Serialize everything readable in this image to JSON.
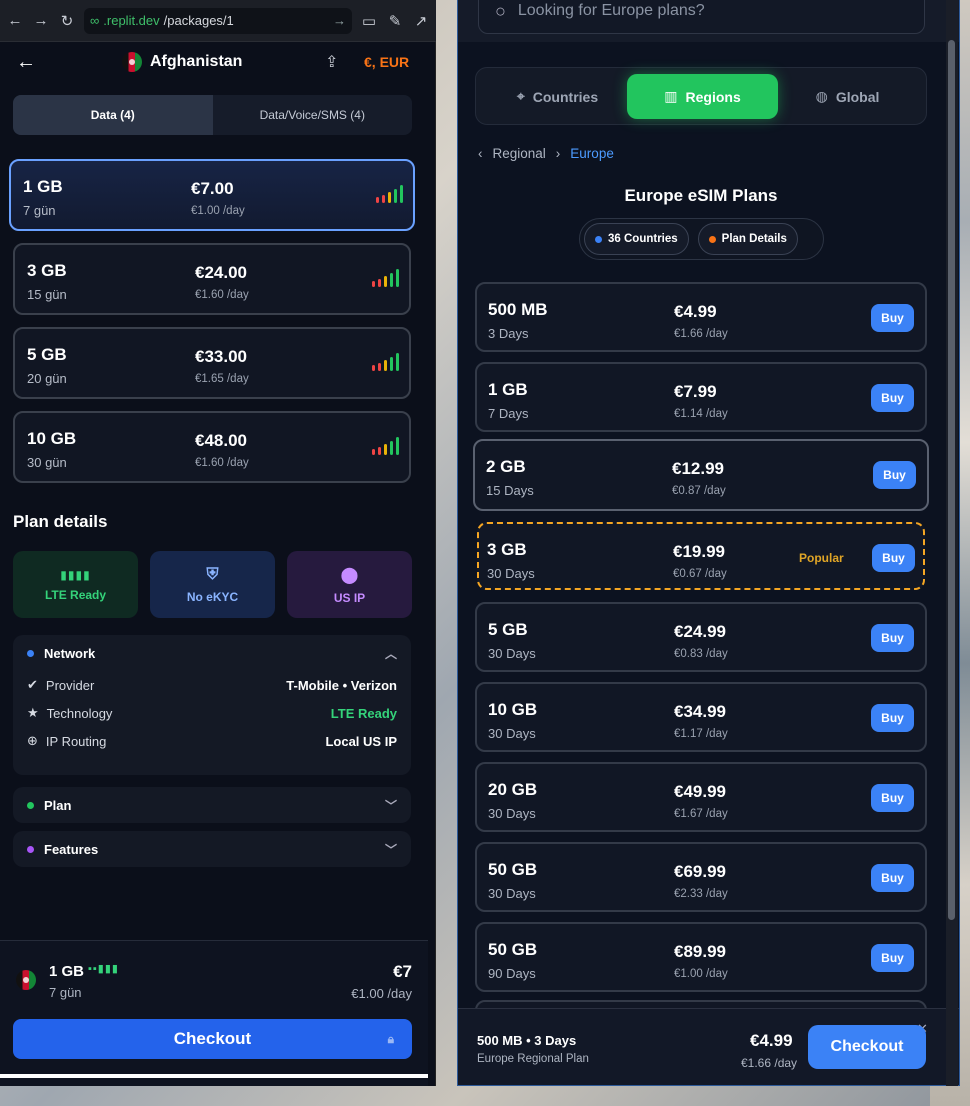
{
  "browser": {
    "url_domain": ".replit.dev",
    "url_path": "/packages/1"
  },
  "left": {
    "country": "Afghanistan",
    "currency": "€, EUR",
    "tabs": [
      {
        "label": "Data (4)"
      },
      {
        "label": "Data/Voice/SMS (4)"
      }
    ],
    "plans": [
      {
        "data": "1 GB",
        "days": "7 gün",
        "price": "€7.00",
        "per_day": "€1.00 /day"
      },
      {
        "data": "3 GB",
        "days": "15 gün",
        "price": "€24.00",
        "per_day": "€1.60 /day"
      },
      {
        "data": "5 GB",
        "days": "20 gün",
        "price": "€33.00",
        "per_day": "€1.65 /day"
      },
      {
        "data": "10 GB",
        "days": "30 gün",
        "price": "€48.00",
        "per_day": "€1.60 /day"
      }
    ],
    "plan_details_title": "Plan details",
    "features": [
      {
        "label": "LTE Ready"
      },
      {
        "label": "No eKYC"
      },
      {
        "label": "US IP"
      }
    ],
    "network": {
      "title": "Network",
      "rows": [
        {
          "label": "Provider",
          "value": "T-Mobile • Verizon"
        },
        {
          "label": "Technology",
          "value": "LTE Ready"
        },
        {
          "label": "IP Routing",
          "value": "Local US IP"
        }
      ]
    },
    "plan_section": "Plan",
    "features_section": "Features",
    "summary": {
      "data": "1 GB",
      "days": "7 gün",
      "price": "€7",
      "per_day": "€1.00 /day"
    },
    "checkout": "Checkout"
  },
  "right": {
    "search_placeholder": "Looking for Europe plans?",
    "segments": [
      {
        "label": "Countries"
      },
      {
        "label": "Regions"
      },
      {
        "label": "Global"
      }
    ],
    "breadcrumb": {
      "parent": "Regional",
      "current": "Europe"
    },
    "title": "Europe eSIM Plans",
    "pills": [
      {
        "label": "36 Countries"
      },
      {
        "label": "Plan Details"
      }
    ],
    "plans": [
      {
        "data": "500 MB",
        "days": "3 Days",
        "price": "€4.99",
        "per_day": "€1.66 /day"
      },
      {
        "data": "1 GB",
        "days": "7 Days",
        "price": "€7.99",
        "per_day": "€1.14 /day"
      },
      {
        "data": "2 GB",
        "days": "15 Days",
        "price": "€12.99",
        "per_day": "€0.87 /day"
      },
      {
        "data": "3 GB",
        "days": "30 Days",
        "price": "€19.99",
        "per_day": "€0.67 /day",
        "tag": "Popular"
      },
      {
        "data": "5 GB",
        "days": "30 Days",
        "price": "€24.99",
        "per_day": "€0.83 /day"
      },
      {
        "data": "10 GB",
        "days": "30 Days",
        "price": "€34.99",
        "per_day": "€1.17 /day"
      },
      {
        "data": "20 GB",
        "days": "30 Days",
        "price": "€49.99",
        "per_day": "€1.67 /day"
      },
      {
        "data": "50 GB",
        "days": "30 Days",
        "price": "€69.99",
        "per_day": "€2.33 /day"
      },
      {
        "data": "50 GB",
        "days": "90 Days",
        "price": "€89.99",
        "per_day": "€1.00 /day"
      }
    ],
    "buy_label": "Buy",
    "summary": {
      "title": "500 MB • 3 Days",
      "subtitle": "Europe Regional Plan",
      "price": "€4.99",
      "per_day": "€1.66 /day"
    },
    "checkout": "Checkout"
  },
  "colors": {
    "accent_blue": "#3b82f6",
    "accent_green": "#22c55e",
    "popular": "#f5a623",
    "currency": "#f97316"
  }
}
